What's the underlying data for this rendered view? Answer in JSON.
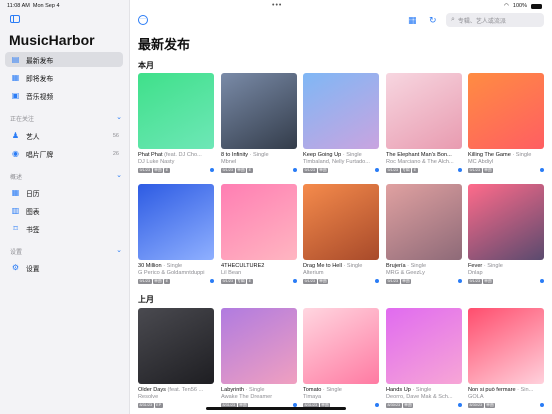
{
  "status": {
    "time": "11:08 AM",
    "date": "Mon Sep 4",
    "battery": "100%",
    "indicator": "•••"
  },
  "sidebar": {
    "app_name": "MusicHarbor",
    "items": [
      {
        "label": "最新发布",
        "icon": "album-icon",
        "glyph": "▤"
      },
      {
        "label": "即将发布",
        "icon": "calendar-clock-icon",
        "glyph": "▦"
      },
      {
        "label": "音乐视频",
        "icon": "video-icon",
        "glyph": "▣"
      }
    ],
    "section_following": "正在关注",
    "following": [
      {
        "label": "艺人",
        "count": "56",
        "icon": "person-icon",
        "glyph": "♟"
      },
      {
        "label": "唱片厂牌",
        "count": "26",
        "icon": "record-icon",
        "glyph": "◉"
      }
    ],
    "section_overview": "概述",
    "overview": [
      {
        "label": "日历",
        "icon": "calendar-icon",
        "glyph": "▦"
      },
      {
        "label": "图表",
        "icon": "chart-icon",
        "glyph": "▥"
      },
      {
        "label": "书签",
        "icon": "bookmark-icon",
        "glyph": "⌑"
      }
    ],
    "section_settings": "设置",
    "settings": [
      {
        "label": "设置",
        "icon": "gear-icon",
        "glyph": "⚙"
      }
    ]
  },
  "toolbar": {
    "more": "···",
    "grid": "▦",
    "refresh": "↻",
    "search_placeholder": "专辑、艺人或流派"
  },
  "main": {
    "title": "最新发布",
    "this_month": "本月",
    "last_month": "上月",
    "cards": [
      {
        "title": "Phat Phat",
        "sub": "(feat. DJ Cho...",
        "artist": "DJ Luke Nasty",
        "tags": [
          "9/1/23",
          "单曲",
          "E"
        ],
        "dot": true,
        "grad": [
          "#3fe08a",
          "#6ee7b7"
        ]
      },
      {
        "title": "8 to Infinity",
        "sub": "· Single",
        "artist": "Mbnel",
        "tags": [
          "9/1/23",
          "单曲",
          "E"
        ],
        "dot": true,
        "grad": [
          "#7a8ba8",
          "#333c4a"
        ]
      },
      {
        "title": "Keep Going Up",
        "sub": "· Single",
        "artist": "Timbaland, Nelly Furtado...",
        "tags": [
          "9/1/23",
          "单曲"
        ],
        "dot": true,
        "grad": [
          "#7fb7f5",
          "#c9a4e0"
        ]
      },
      {
        "title": "The Elephant Man's Bon...",
        "sub": "",
        "artist": "Roc Marciano & The Alch...",
        "tags": [
          "9/1/23",
          "专辑",
          "E"
        ],
        "dot": true,
        "grad": [
          "#f7d6e0",
          "#e89bb0"
        ]
      },
      {
        "title": "Killing The Game",
        "sub": "· Single",
        "artist": "MC Abdiyl",
        "tags": [
          "9/1/23",
          "单曲"
        ],
        "dot": true,
        "grad": [
          "#ff8c42",
          "#ff5e62"
        ]
      },
      {
        "title": "30 Million",
        "sub": "· Single",
        "artist": "G Perico & Goldamntduppi",
        "tags": [
          "9/1/23",
          "单曲",
          "E"
        ],
        "dot": true,
        "grad": [
          "#2d5be3",
          "#8fb0ff"
        ]
      },
      {
        "title": "4THECULTURE2",
        "sub": "",
        "artist": "Lil Bean",
        "tags": [
          "9/1/23",
          "专辑",
          "E"
        ],
        "dot": true,
        "grad": [
          "#ff7eb3",
          "#ffb6c1"
        ]
      },
      {
        "title": "Drag Me to Hell",
        "sub": "· Single",
        "artist": "Alterium",
        "tags": [
          "9/1/23",
          "单曲"
        ],
        "dot": true,
        "grad": [
          "#f58b4c",
          "#a84a2a"
        ]
      },
      {
        "title": "Brujería",
        "sub": "· Single",
        "artist": "MRG & GeezLy",
        "tags": [
          "9/1/23",
          "单曲"
        ],
        "dot": true,
        "grad": [
          "#e0a1a1",
          "#8e6a78"
        ]
      },
      {
        "title": "Fever",
        "sub": "· Single",
        "artist": "Dnlap",
        "tags": [
          "9/1/23",
          "单曲"
        ],
        "dot": true,
        "grad": [
          "#ff6b8b",
          "#5a4a6e"
        ]
      },
      {
        "title": "Older Days",
        "sub": "(feat. Ten56 ...",
        "artist": "Resolve",
        "tags": [
          "8/31/23",
          "EP"
        ],
        "dot": false,
        "grad": [
          "#4a4a50",
          "#1e1e22"
        ]
      },
      {
        "title": "Labyrinth",
        "sub": "· Single",
        "artist": "Awake The Dreamer",
        "tags": [
          "8/31/23",
          "单曲"
        ],
        "dot": true,
        "grad": [
          "#b07be0",
          "#f0a0c0"
        ]
      },
      {
        "title": "Tomato",
        "sub": "· Single",
        "artist": "Timaya",
        "tags": [
          "8/31/23",
          "单曲"
        ],
        "dot": true,
        "grad": [
          "#ffd6e0",
          "#ff7aa2"
        ]
      },
      {
        "title": "Hands Up",
        "sub": "· Single",
        "artist": "Deorro, Dave Mak & Sch...",
        "tags": [
          "8/30/23",
          "单曲"
        ],
        "dot": true,
        "grad": [
          "#e06bf0",
          "#f7a6d6"
        ]
      },
      {
        "title": "Non si può fermare",
        "sub": "· Sin...",
        "artist": "GOLA",
        "tags": [
          "8/30/23",
          "单曲"
        ],
        "dot": true,
        "grad": [
          "#ff4d6d",
          "#ffd1dc"
        ]
      }
    ]
  }
}
